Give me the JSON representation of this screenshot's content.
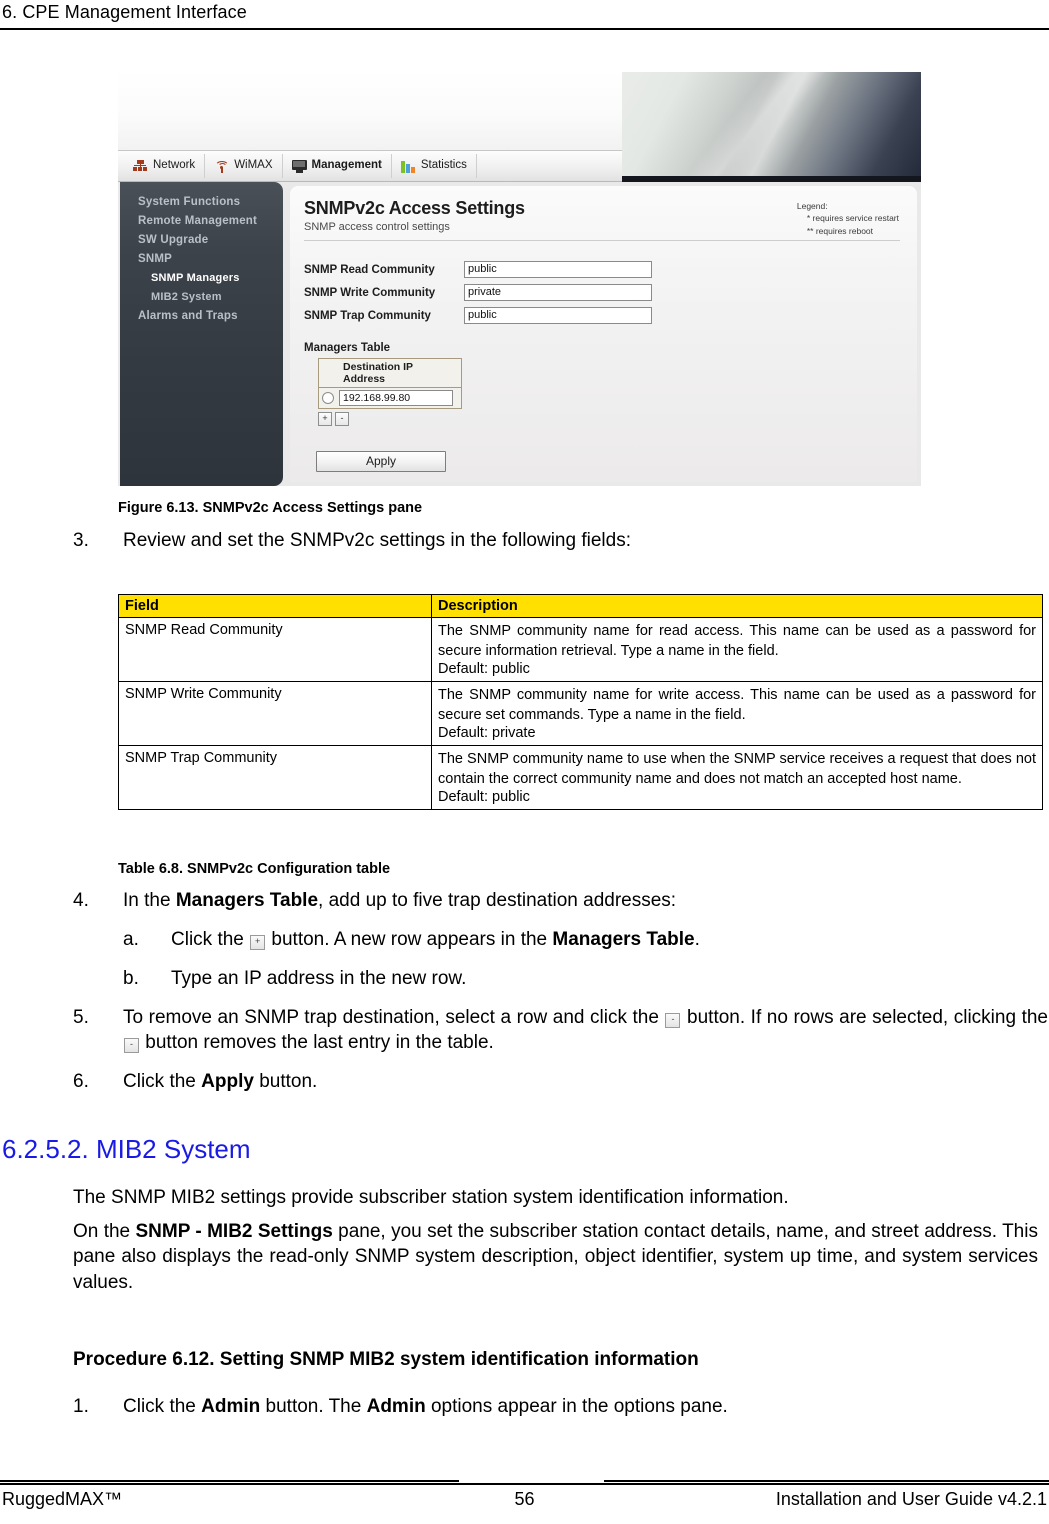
{
  "page": {
    "running_header": "6. CPE Management Interface",
    "footer_left": "RuggedMAX™",
    "footer_page_number": "56",
    "footer_right": "Installation and User Guide v4.2.1"
  },
  "figure": {
    "caption": "Figure 6.13. SNMPv2c Access Settings pane",
    "app": {
      "tabs": [
        {
          "label": "Network",
          "icon": "network-icon",
          "active": false
        },
        {
          "label": "WiMAX",
          "icon": "wimax-antenna-icon",
          "active": false
        },
        {
          "label": "Management",
          "icon": "monitor-icon",
          "active": true
        },
        {
          "label": "Statistics",
          "icon": "bar-chart-icon",
          "active": false
        }
      ],
      "nav_items": [
        {
          "label": "System Functions",
          "level": 0,
          "selected": false
        },
        {
          "label": "Remote Management",
          "level": 0,
          "selected": false
        },
        {
          "label": "SW Upgrade",
          "level": 0,
          "selected": false
        },
        {
          "label": "SNMP",
          "level": 0,
          "selected": false
        },
        {
          "label": "SNMP Managers",
          "level": 1,
          "selected": true
        },
        {
          "label": "MIB2 System",
          "level": 1,
          "selected": false
        },
        {
          "label": "Alarms and Traps",
          "level": 0,
          "selected": false
        }
      ],
      "pane_title": "SNMPv2c Access Settings",
      "pane_subtitle": "SNMP access control settings",
      "legend": {
        "title": "Legend:",
        "lines": [
          "*  requires service restart",
          "** requires reboot"
        ]
      },
      "fields": [
        {
          "label": "SNMP Read Community",
          "value": "public"
        },
        {
          "label": "SNMP Write Community",
          "value": "private"
        },
        {
          "label": "SNMP Trap Community",
          "value": "public"
        }
      ],
      "managers_table": {
        "title": "Managers Table",
        "column_header": "Destination IP Address",
        "rows": [
          {
            "value": "192.168.99.80"
          }
        ],
        "add_button": "+",
        "remove_button": "-"
      },
      "apply_button": "Apply"
    }
  },
  "step3": {
    "number": "3.",
    "text": "Review and set the SNMPv2c settings in the following fields:"
  },
  "config_table": {
    "caption": "Table 6.8. SNMPv2c Configuration table",
    "headers": [
      "Field",
      "Description"
    ],
    "rows": [
      {
        "field": "SNMP Read Community",
        "description": "The SNMP community name for read access. This name can be used as a password for secure information retrieval. Type a name in the field.",
        "default": "Default: public"
      },
      {
        "field": "SNMP Write Community",
        "description": "The SNMP community name for write access. This name can be used as a password for secure set commands. Type a name in the field.",
        "default": "Default: private"
      },
      {
        "field": "SNMP Trap Community",
        "description": "The SNMP community name to use when the SNMP service receives a request that does not contain the correct community name and does not match an accepted host name.",
        "default": "Default: public"
      }
    ]
  },
  "steps": {
    "step4": {
      "number": "4.",
      "prefix": "In the ",
      "bold": "Managers Table",
      "suffix": ", add up to five trap destination addresses:"
    },
    "step4a": {
      "letter": "a.",
      "prefix": "Click the ",
      "icon": "+",
      "middle": " button. A new row appears in the ",
      "bold": "Managers Table",
      "suffix": "."
    },
    "step4b": {
      "letter": "b.",
      "text": "Type an IP address in the new row."
    },
    "step5": {
      "number": "5.",
      "part1": "To remove an SNMP trap destination, select a row and click the ",
      "icon1": "-",
      "part2": " button. If no rows are selected, clicking the ",
      "icon2": "-",
      "part3": " button removes the last entry in the table."
    },
    "step6": {
      "number": "6.",
      "prefix": "Click the ",
      "bold": "Apply",
      "suffix": " button."
    }
  },
  "section": {
    "heading": "6.2.5.2. MIB2 System",
    "heading_color": "#1a1ae6",
    "paragraph1": "The SNMP MIB2 settings provide subscriber station system identification information.",
    "paragraph2": {
      "prefix": "On the ",
      "bold": "SNMP - MIB2 Settings",
      "suffix": " pane, you set the subscriber station contact details, name, and street address. This pane also displays the read-only SNMP system description, object identifier, system up time, and system services values."
    },
    "procedure_heading": "Procedure 6.12.  Setting SNMP MIB2 system identification information",
    "procedure_step1": {
      "number": "1.",
      "part1": "Click the ",
      "bold1": "Admin",
      "part2": " button. The ",
      "bold2": "Admin",
      "part3": " options appear in the options pane."
    }
  }
}
